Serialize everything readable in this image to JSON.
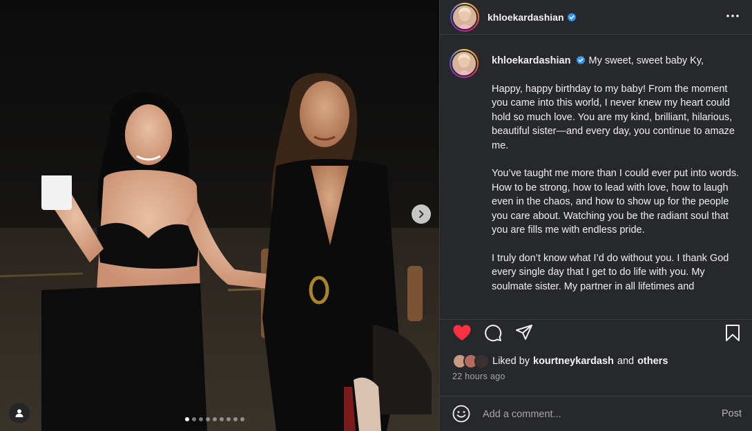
{
  "post": {
    "author": "khloekardashian",
    "verified": true
  },
  "caption": {
    "author": "khloekardashian",
    "first_line": "My sweet, sweet baby Ky,",
    "paragraphs": [
      "Happy, happy birthday to my baby! From the moment you came into this world, I never knew my heart could hold so much love. You are my kind, brilliant, hilarious, beautiful sister—and every day, you continue to amaze me.",
      "You’ve taught me more than I could ever put into words. How to be strong, how to lead with love, how to laugh even in the chaos, and how to show up for the people you care about. Watching you be the radiant soul that you are fills me with endless pride.",
      "I truly don’t know what I’d do without you. I thank God every single day that I get to do life with you. My soulmate sister. My partner in all lifetimes and"
    ]
  },
  "likes": {
    "prefix": "Liked by",
    "user": "kourtneykardash",
    "conjunction": "and",
    "others": "others"
  },
  "timestamp": "22 hours ago",
  "comment": {
    "placeholder": "Add a comment...",
    "post_label": "Post"
  },
  "carousel": {
    "total_slides": 9,
    "current_slide": 1
  },
  "colors": {
    "like_red": "#ff3040",
    "verified_blue": "#3897f0",
    "panel_bg": "#26282c"
  },
  "icons": [
    "more-icon",
    "heart-icon",
    "comment-icon",
    "share-icon",
    "bookmark-icon",
    "emoji-icon",
    "chevron-right-icon",
    "user-tag-icon",
    "verified-badge-icon"
  ]
}
